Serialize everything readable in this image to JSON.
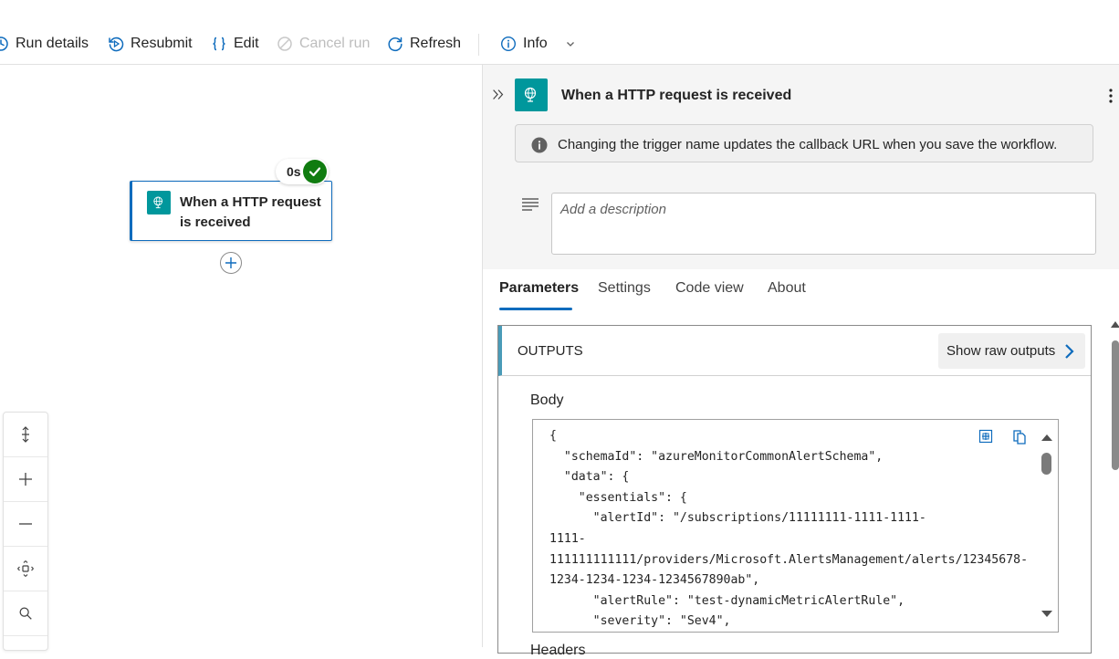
{
  "toolbar": {
    "run_details": "Run details",
    "resubmit": "Resubmit",
    "edit": "Edit",
    "cancel_run": "Cancel run",
    "refresh": "Refresh",
    "info": "Info"
  },
  "canvas": {
    "node_title": "When a HTTP request is received",
    "duration": "0s",
    "status": "succeeded"
  },
  "panel": {
    "title": "When a HTTP request is received",
    "info_message": "Changing the trigger name updates the callback URL when you save the workflow.",
    "description_placeholder": "Add a description",
    "tabs": [
      "Parameters",
      "Settings",
      "Code view",
      "About"
    ],
    "active_tab": "Parameters",
    "outputs": {
      "label": "OUTPUTS",
      "show_raw_label": "Show raw outputs",
      "body_label": "Body",
      "body_code": "{\n  \"schemaId\": \"azureMonitorCommonAlertSchema\",\n  \"data\": {\n    \"essentials\": {\n      \"alertId\": \"/subscriptions/11111111-1111-1111-\n1111-\n111111111111/providers/Microsoft.AlertsManagement/alerts/12345678-\n1234-1234-1234-1234567890ab\",\n      \"alertRule\": \"test-dynamicMetricAlertRule\",\n      \"severity\": \"Sev4\",",
      "next_label": "Headers"
    }
  },
  "colors": {
    "accent": "#0f6cbd",
    "trigger_icon_bg": "#00979c",
    "success": "#107c10",
    "outputs_bar": "#4a9bb8"
  },
  "icons": [
    "history-icon",
    "resubmit-icon",
    "braces-icon",
    "cancel-icon",
    "refresh-icon",
    "info-icon",
    "chevron-down-icon",
    "globe-request-icon",
    "check-icon",
    "plus-icon",
    "fit-vertical-icon",
    "zoom-in-icon",
    "zoom-out-icon",
    "fit-view-icon",
    "search-icon",
    "collapse-icon",
    "more-icon",
    "text-lines-icon",
    "chevron-right-icon",
    "format-icon",
    "copy-icon",
    "caret-up-icon",
    "caret-down-icon"
  ]
}
